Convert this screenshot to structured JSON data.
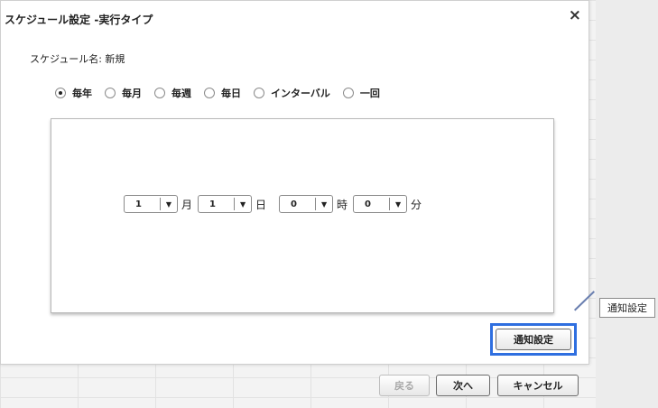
{
  "dialog": {
    "title": "スケジュール設定 -実行タイプ",
    "close_label": "×",
    "schedule_name_label": "スケジュール名: 新規"
  },
  "schedule_types": [
    {
      "label": "毎年",
      "checked": true
    },
    {
      "label": "毎月",
      "checked": false
    },
    {
      "label": "毎週",
      "checked": false
    },
    {
      "label": "毎日",
      "checked": false
    },
    {
      "label": "インターバル",
      "checked": false
    },
    {
      "label": "一回",
      "checked": false
    }
  ],
  "time_fields": {
    "month": {
      "value": "1",
      "unit": "月"
    },
    "day": {
      "value": "1",
      "unit": "日"
    },
    "hour": {
      "value": "0",
      "unit": "時"
    },
    "minute": {
      "value": "0",
      "unit": "分"
    }
  },
  "buttons": {
    "notify_label": "通知設定",
    "back_label": "戻る",
    "next_label": "次へ",
    "cancel_label": "キャンセル"
  },
  "callout": {
    "label": "通知設定",
    "highlight_color": "#2f6fe0"
  }
}
